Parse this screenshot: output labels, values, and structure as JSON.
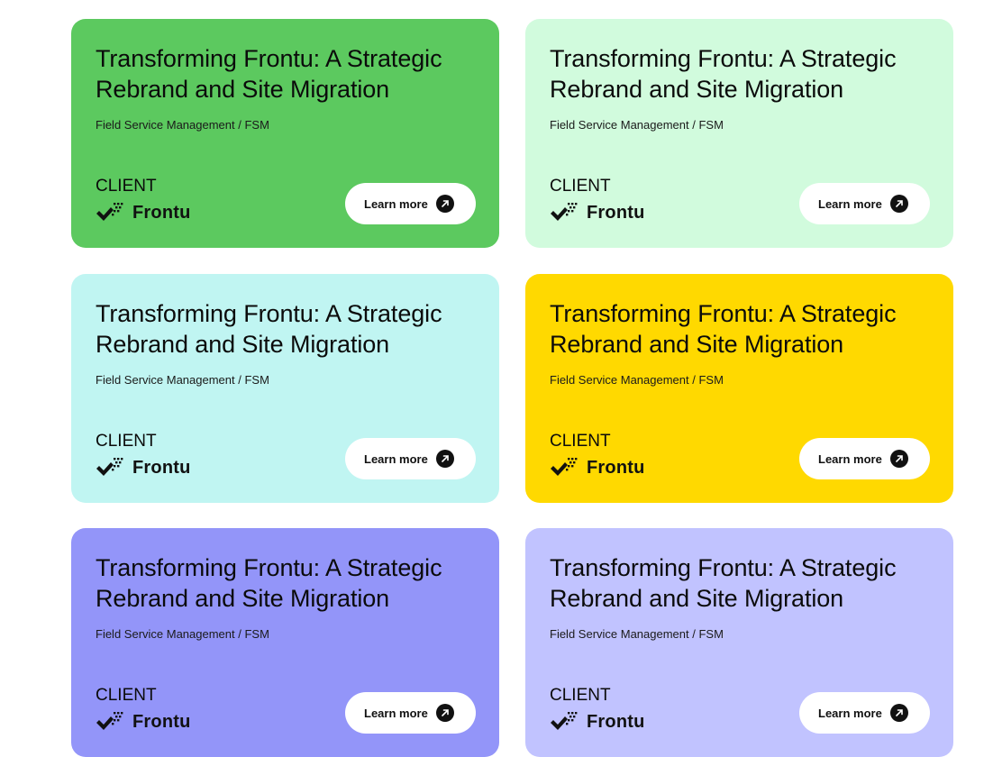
{
  "cards": [
    {
      "title": "Transforming Frontu: A Strategic Rebrand and Site Migration",
      "category": "Field Service Management / FSM",
      "client_label": "CLIENT",
      "client_logo_text": "Frontu",
      "button_label": "Learn more",
      "background": "#5cc95f"
    },
    {
      "title": "Transforming Frontu: A Strategic Rebrand and Site Migration",
      "category": "Field Service Management / FSM",
      "client_label": "CLIENT",
      "client_logo_text": "Frontu",
      "button_label": "Learn more",
      "background": "#d1fbdd"
    },
    {
      "title": "Transforming Frontu: A Strategic Rebrand and Site Migration",
      "category": "Field Service Management / FSM",
      "client_label": "CLIENT",
      "client_logo_text": "Frontu",
      "button_label": "Learn more",
      "background": "#c0f5f2"
    },
    {
      "title": "Transforming Frontu: A Strategic Rebrand and Site Migration",
      "category": "Field Service Management / FSM",
      "client_label": "CLIENT",
      "client_logo_text": "Frontu",
      "button_label": "Learn more",
      "background": "#ffd900"
    },
    {
      "title": "Transforming Frontu: A Strategic Rebrand and Site Migration",
      "category": "Field Service Management / FSM",
      "client_label": "CLIENT",
      "client_logo_text": "Frontu",
      "button_label": "Learn more",
      "background": "#9395f9"
    },
    {
      "title": "Transforming Frontu: A Strategic Rebrand and Site Migration",
      "category": "Field Service Management / FSM",
      "client_label": "CLIENT",
      "client_logo_text": "Frontu",
      "button_label": "Learn more",
      "background": "#c1c3ff"
    }
  ],
  "icons": {
    "logo": "frontu-checkmark-logo",
    "button": "arrow-up-right-icon"
  }
}
